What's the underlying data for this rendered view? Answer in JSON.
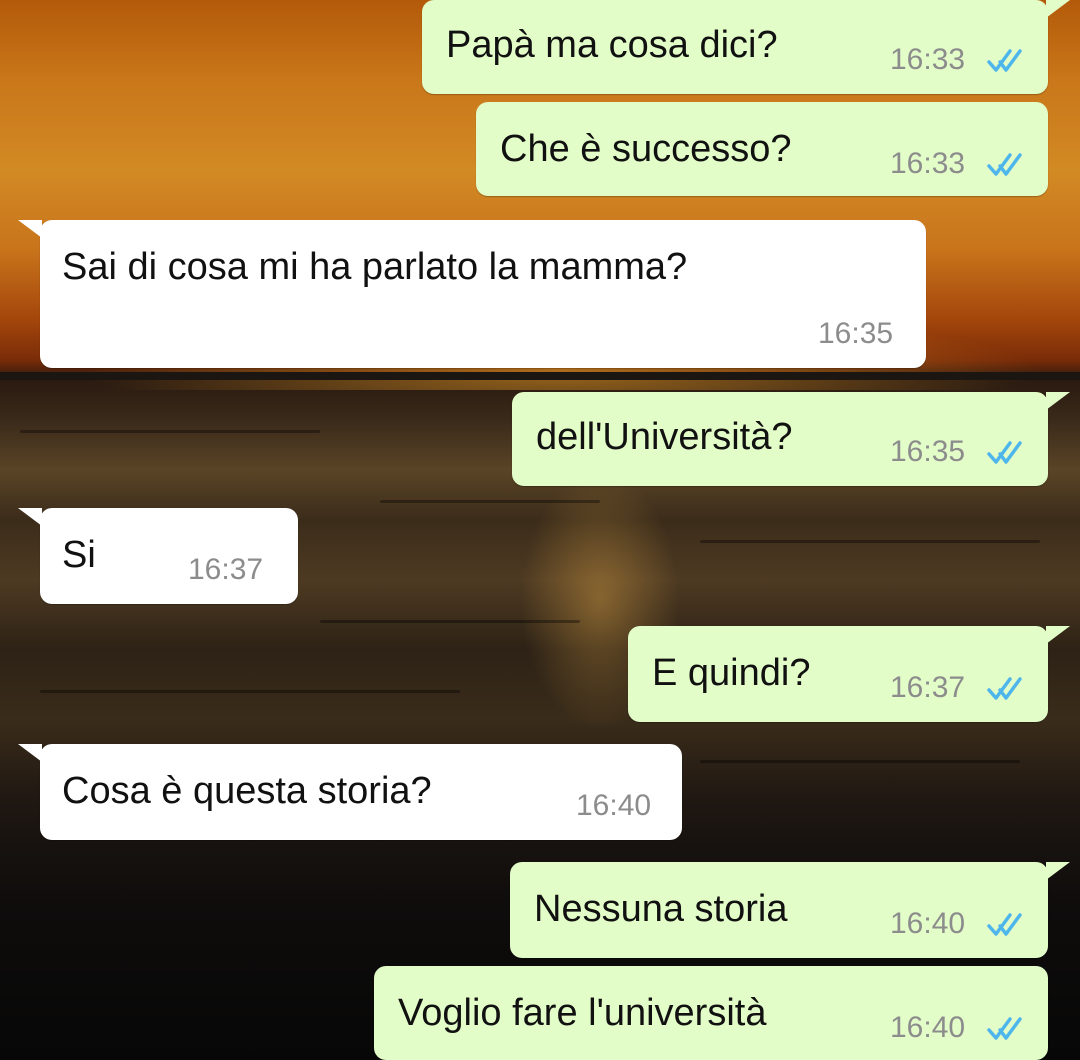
{
  "theme": {
    "outgoing_bubble": "#e3fdc8",
    "incoming_bubble": "#ffffff",
    "read_tick": "#4fb6ec"
  },
  "messages": [
    {
      "direction": "outgoing",
      "text": "Papà ma cosa dici?",
      "time": "16:33",
      "status": "read"
    },
    {
      "direction": "outgoing",
      "text": "Che è successo?",
      "time": "16:33",
      "status": "read"
    },
    {
      "direction": "incoming",
      "text": "Sai di cosa mi ha parlato la mamma?",
      "time": "16:35"
    },
    {
      "direction": "outgoing",
      "text": "dell'Università?",
      "time": "16:35",
      "status": "read"
    },
    {
      "direction": "incoming",
      "text": "Si",
      "time": "16:37"
    },
    {
      "direction": "outgoing",
      "text": "E quindi?",
      "time": "16:37",
      "status": "read"
    },
    {
      "direction": "incoming",
      "text": "Cosa è questa storia?",
      "time": "16:40"
    },
    {
      "direction": "outgoing",
      "text": "Nessuna storia",
      "time": "16:40",
      "status": "read"
    },
    {
      "direction": "outgoing",
      "text": "Voglio fare l'università",
      "time": "16:40",
      "status": "read"
    }
  ]
}
